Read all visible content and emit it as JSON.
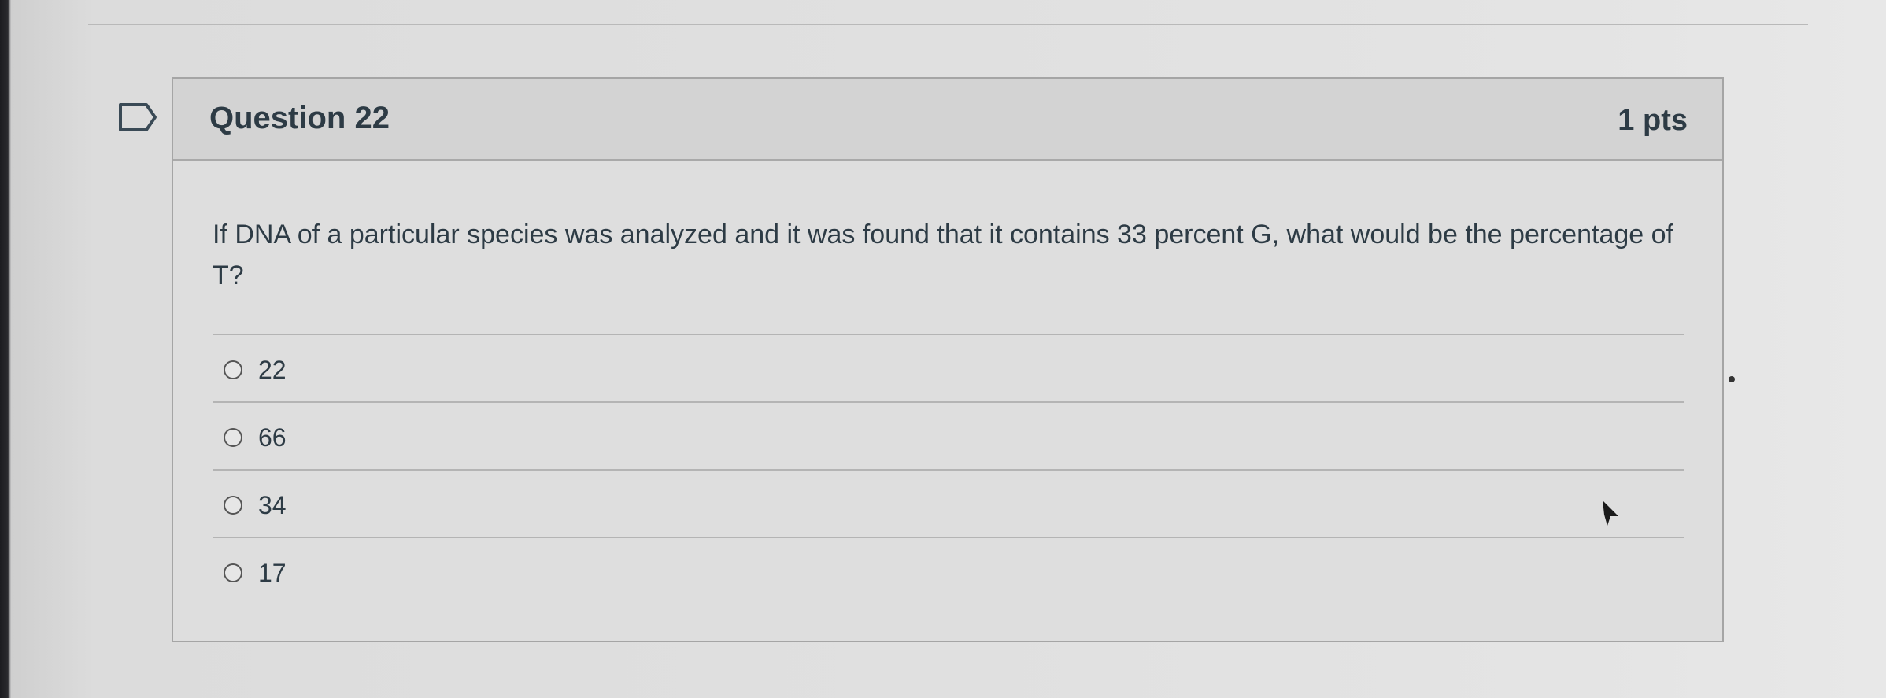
{
  "question": {
    "title": "Question 22",
    "points": "1 pts",
    "text": "If DNA of a particular species was analyzed and it was found that it contains 33 percent G, what would be the percentage of T?"
  },
  "answers": [
    {
      "label": "22",
      "selected": false
    },
    {
      "label": "66",
      "selected": false
    },
    {
      "label": "34",
      "selected": false
    },
    {
      "label": "17",
      "selected": false
    }
  ],
  "icons": {
    "flag": "flag-icon",
    "cursor": "pointer-cursor-icon"
  },
  "colors": {
    "text": "#2d3b45",
    "header_bg": "#d3d3d3",
    "border": "#a5a5a5"
  }
}
